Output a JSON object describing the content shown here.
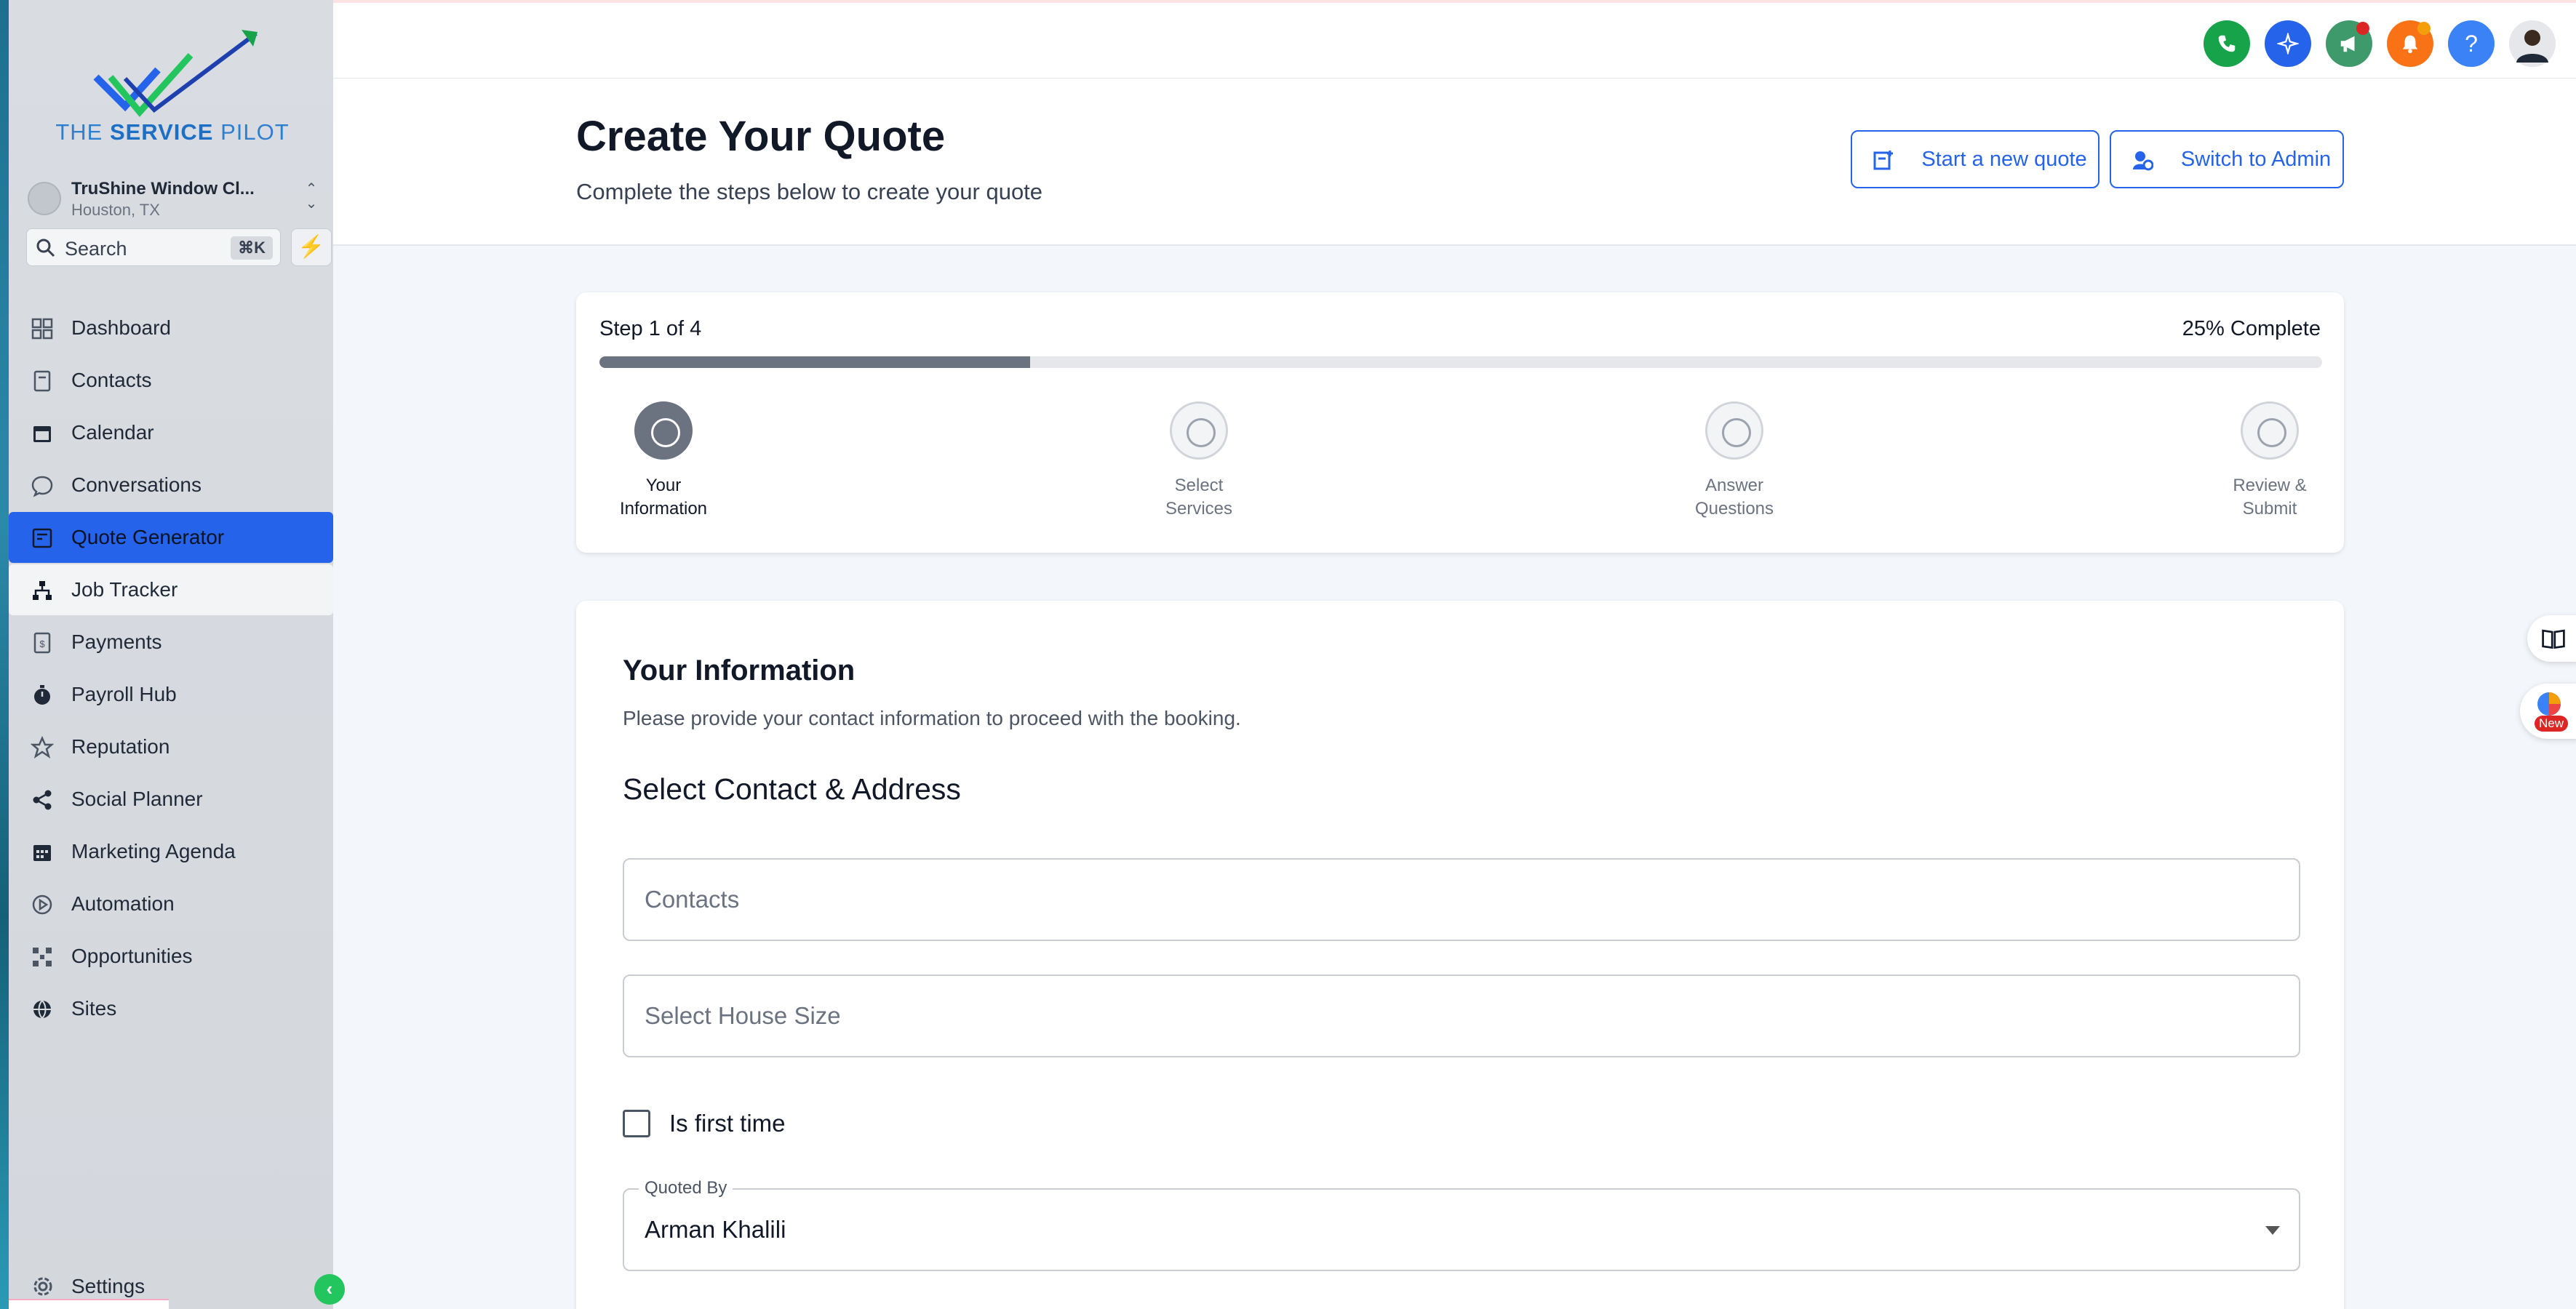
{
  "brand": {
    "logo_text_prefix": "THE ",
    "logo_text_bold": "SERVICE",
    "logo_text_suffix": " PILOT"
  },
  "account": {
    "name": "TruShine Window Cl...",
    "location": "Houston, TX"
  },
  "search": {
    "label": "Search",
    "shortcut": "⌘K"
  },
  "nav": {
    "items": [
      {
        "label": "Dashboard",
        "icon": "dashboard-icon"
      },
      {
        "label": "Contacts",
        "icon": "contacts-icon"
      },
      {
        "label": "Calendar",
        "icon": "calendar-icon"
      },
      {
        "label": "Conversations",
        "icon": "chat-icon"
      },
      {
        "label": "Quote Generator",
        "icon": "quote-icon",
        "active": true
      },
      {
        "label": "Job Tracker",
        "icon": "sitemap-icon"
      },
      {
        "label": "Payments",
        "icon": "payments-icon"
      },
      {
        "label": "Payroll Hub",
        "icon": "stopwatch-icon"
      },
      {
        "label": "Reputation",
        "icon": "star-icon"
      },
      {
        "label": "Social Planner",
        "icon": "share-icon"
      },
      {
        "label": "Marketing Agenda",
        "icon": "calendar-grid-icon"
      },
      {
        "label": "Automation",
        "icon": "play-circle-icon"
      },
      {
        "label": "Opportunities",
        "icon": "opportunities-icon"
      },
      {
        "label": "Sites",
        "icon": "globe-icon"
      }
    ],
    "settings_label": "Settings"
  },
  "topbar": {
    "icons": [
      {
        "name": "phone-icon",
        "color": "#16a34a"
      },
      {
        "name": "sparkle-icon",
        "color": "#2563eb"
      },
      {
        "name": "megaphone-icon",
        "color": "#3f9a6b",
        "dot": "#dc2626"
      },
      {
        "name": "bell-icon",
        "color": "#f97316",
        "dot": "#f59e0b"
      },
      {
        "name": "help-icon",
        "color": "#3b82f6"
      },
      {
        "name": "user-avatar",
        "color": "#e5e7eb"
      }
    ],
    "help_glyph": "?"
  },
  "header": {
    "title": "Create Your Quote",
    "subtitle": "Complete the steps below to create your quote",
    "start_button": "Start a new quote",
    "admin_button": "Switch to Admin"
  },
  "progress": {
    "step_text": "Step 1 of 4",
    "percent_text": "25% Complete",
    "percent": 25,
    "steps": [
      {
        "line1": "Your",
        "line2": "Information",
        "active": true
      },
      {
        "line1": "Select",
        "line2": "Services",
        "active": false
      },
      {
        "line1": "Answer",
        "line2": "Questions",
        "active": false
      },
      {
        "line1": "Review &",
        "line2": "Submit",
        "active": false
      }
    ]
  },
  "form": {
    "title": "Your Information",
    "description": "Please provide your contact information to proceed with the booking.",
    "section_title": "Select Contact & Address",
    "contacts_placeholder": "Contacts",
    "house_size_placeholder": "Select House Size",
    "first_time_label": "Is first time",
    "first_time_checked": false,
    "quoted_by_label": "Quoted By",
    "quoted_by_value": "Arman Khalili"
  },
  "floating": {
    "new_badge": "New"
  },
  "colors": {
    "accent": "#2563eb",
    "progress_fill": "#6b7280",
    "success": "#22c55e"
  }
}
